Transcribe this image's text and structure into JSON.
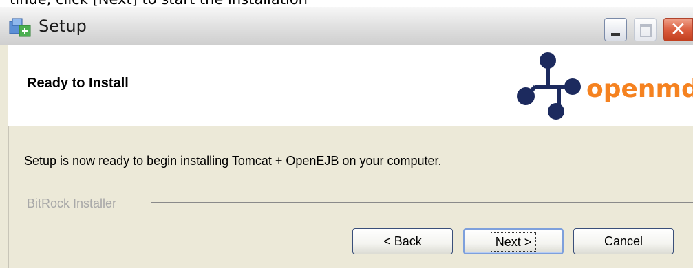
{
  "top_fragment": "tinue, click [Next] to start the installation",
  "window": {
    "title": "Setup",
    "controls": {
      "minimize_icon": "minimize-icon",
      "maximize_icon": "maximize-icon",
      "close_glyph": "✕"
    }
  },
  "header": {
    "title": "Ready to Install",
    "logo_text": "openmdx",
    "logo_colors": {
      "mark": "#1c2a5e",
      "text": "#f58220"
    }
  },
  "body": {
    "message": "Setup is now ready to begin installing Tomcat + OpenEJB on your computer.",
    "vendor": "BitRock Installer"
  },
  "buttons": {
    "back": "< Back",
    "next": "Next >",
    "cancel": "Cancel"
  }
}
